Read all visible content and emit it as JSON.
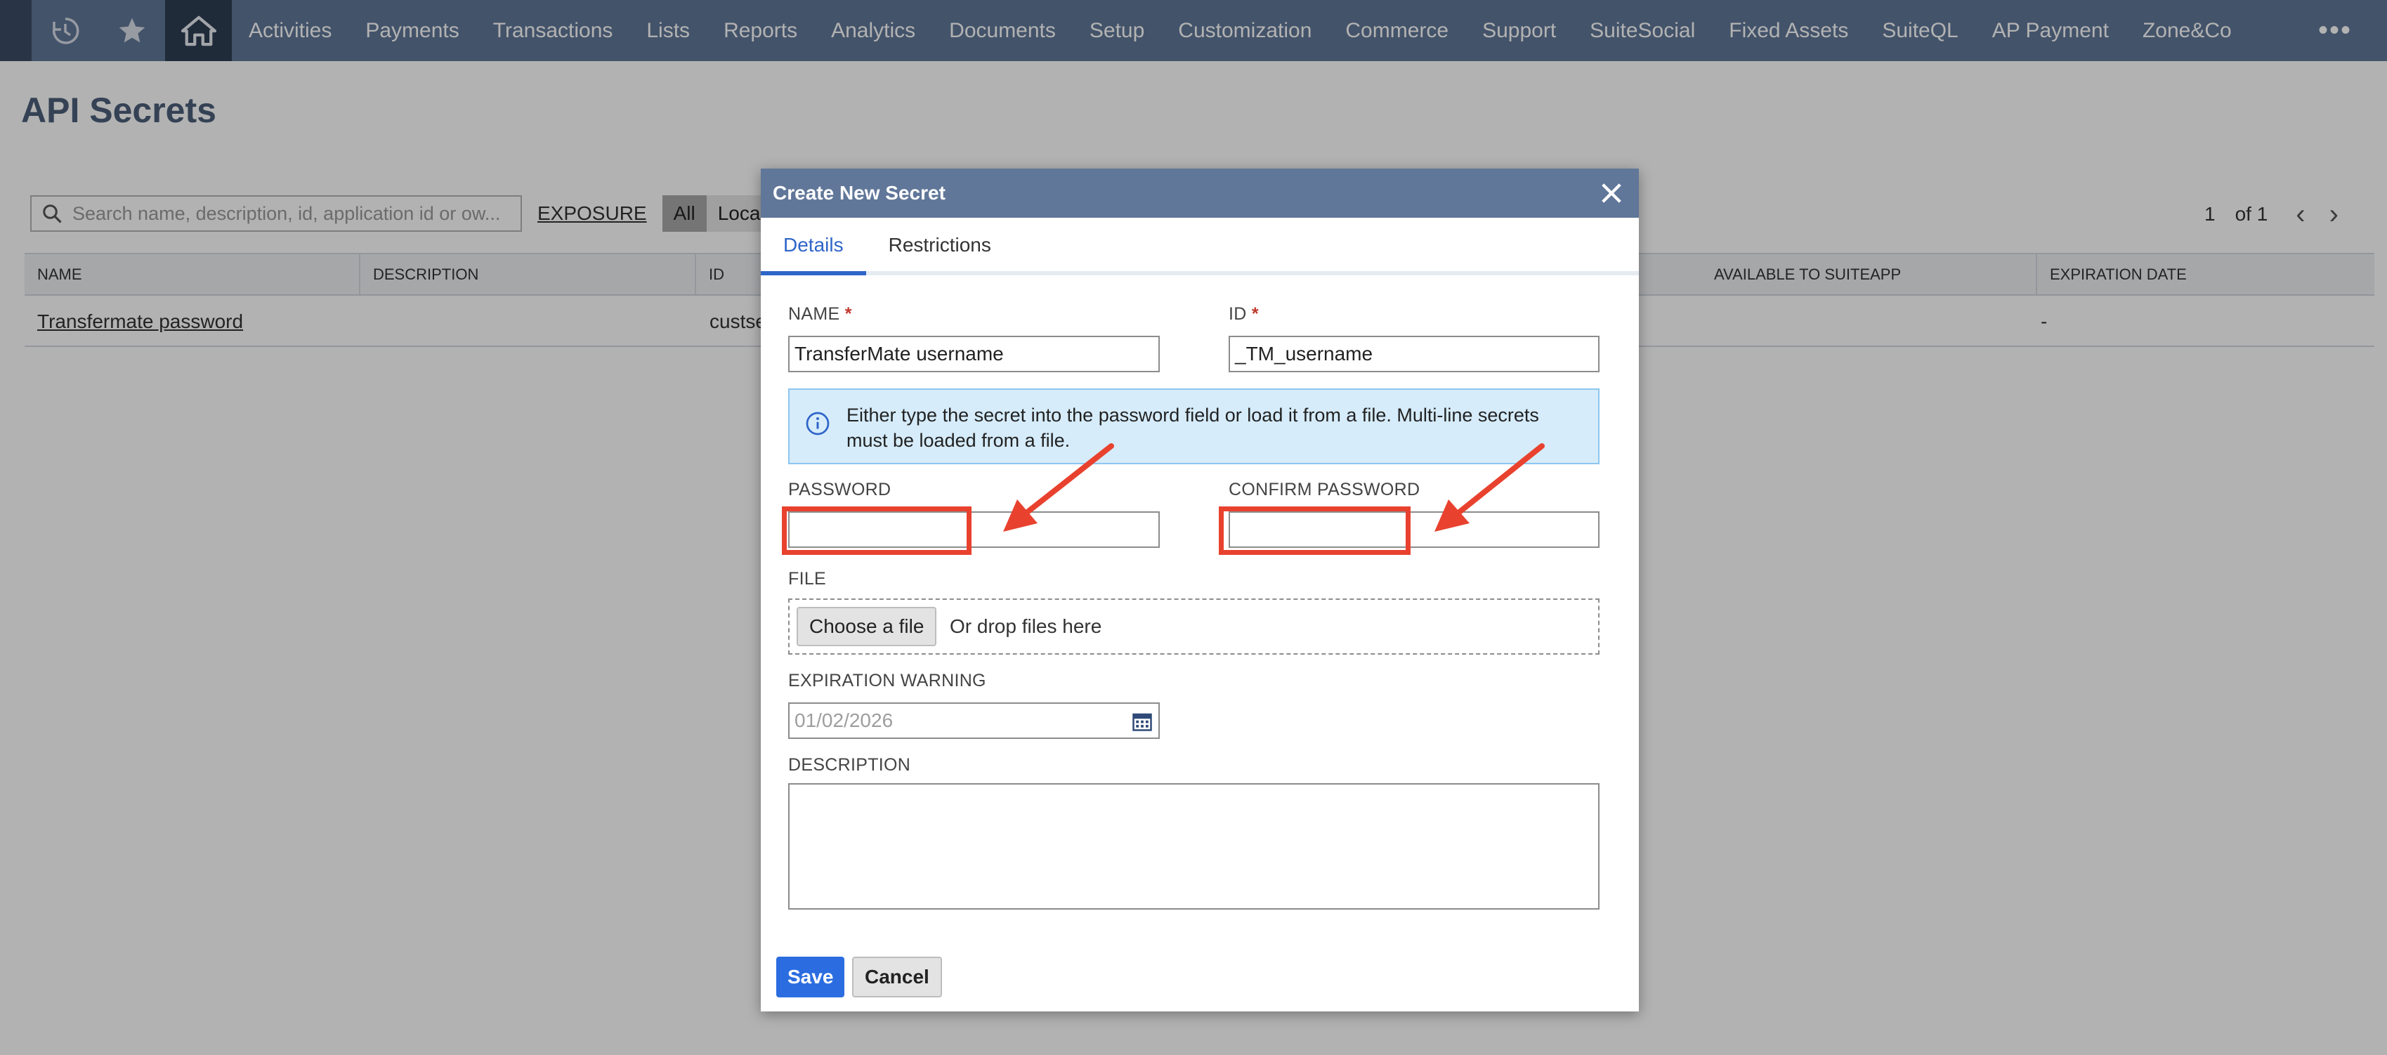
{
  "nav": {
    "items": [
      "Activities",
      "Payments",
      "Transactions",
      "Lists",
      "Reports",
      "Analytics",
      "Documents",
      "Setup",
      "Customization",
      "Commerce",
      "Support",
      "SuiteSocial",
      "Fixed Assets",
      "SuiteQL",
      "AP Payment",
      "Zone&Co"
    ],
    "more_label": "•••",
    "icons": [
      "recent-records-icon",
      "star-icon",
      "home-icon",
      "more-icon"
    ]
  },
  "page": {
    "title": "API Secrets",
    "search_placeholder": "Search name, description, id, application id or ow...",
    "exposure_label": "EXPOSURE",
    "exposure_options": [
      "All",
      "Local"
    ],
    "exposure_selected": "All",
    "pager": {
      "page": "1",
      "of": "of 1"
    }
  },
  "table": {
    "columns": [
      "NAME",
      "DESCRIPTION",
      "ID",
      "AVAILABLE TO SUITEAPP",
      "EXPIRATION DATE"
    ],
    "rows": [
      {
        "name": "Transfermate password",
        "description": "",
        "id": "custse",
        "available": "",
        "expiration": "-"
      }
    ]
  },
  "modal": {
    "title": "Create New Secret",
    "tabs": [
      "Details",
      "Restrictions"
    ],
    "active_tab": "Details",
    "name_label": "NAME",
    "name_value": "TransferMate username",
    "id_label": "ID",
    "id_value": "_TM_username",
    "required_marker": "*",
    "info_text": "Either type the secret into the password field or load it from a file. Multi-line secrets must be loaded from a file.",
    "password_label": "PASSWORD",
    "confirm_password_label": "CONFIRM PASSWORD",
    "file_label": "FILE",
    "choose_file_label": "Choose a file",
    "drop_text": "Or drop files here",
    "expiration_label": "EXPIRATION WARNING",
    "expiration_placeholder": "01/02/2026",
    "description_label": "DESCRIPTION",
    "save_label": "Save",
    "cancel_label": "Cancel"
  },
  "colors": {
    "nav_bg": "#607799",
    "accent": "#2f65c9",
    "save_button": "#2b6de0",
    "annotation": "#e8422f",
    "info_bg": "#d6ecfb"
  }
}
